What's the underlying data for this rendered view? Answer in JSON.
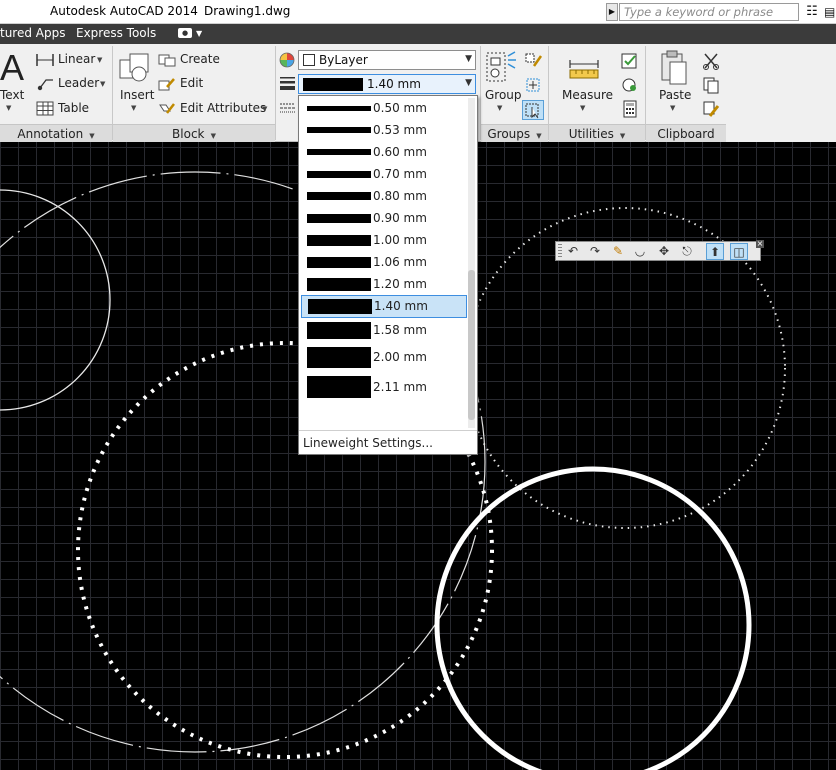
{
  "window": {
    "app_title": "Autodesk AutoCAD 2014",
    "document": "Drawing1.dwg",
    "search_placeholder": "Type a keyword or phrase"
  },
  "ribbon_tabs": [
    {
      "label": "tured Apps"
    },
    {
      "label": "Express Tools"
    }
  ],
  "annotation": {
    "text_label": "Text",
    "linear_label": "Linear",
    "leader_label": "Leader",
    "table_label": "Table",
    "panel_label": "Annotation"
  },
  "block": {
    "insert_label": "Insert",
    "create_label": "Create",
    "edit_label": "Edit",
    "edit_attributes_label": "Edit Attributes",
    "panel_label": "Block"
  },
  "properties": {
    "color_value": "ByLayer",
    "lineweight_value": "1.40 mm"
  },
  "groups": {
    "group_label": "Group",
    "panel_label": "Groups"
  },
  "utilities": {
    "measure_label": "Measure",
    "panel_label": "Utilities"
  },
  "clipboard": {
    "paste_label": "Paste",
    "panel_label": "Clipboard"
  },
  "lineweight_dropdown": {
    "items": [
      {
        "label": "0.50 mm",
        "weight": 0.5
      },
      {
        "label": "0.53 mm",
        "weight": 0.53
      },
      {
        "label": "0.60 mm",
        "weight": 0.6
      },
      {
        "label": "0.70 mm",
        "weight": 0.7
      },
      {
        "label": "0.80 mm",
        "weight": 0.8
      },
      {
        "label": "0.90 mm",
        "weight": 0.9
      },
      {
        "label": "1.00 mm",
        "weight": 1.0
      },
      {
        "label": "1.06 mm",
        "weight": 1.06
      },
      {
        "label": "1.20 mm",
        "weight": 1.2
      },
      {
        "label": "1.40 mm",
        "weight": 1.4
      },
      {
        "label": "1.58 mm",
        "weight": 1.58
      },
      {
        "label": "2.00 mm",
        "weight": 2.0
      },
      {
        "label": "2.11 mm",
        "weight": 2.11
      }
    ],
    "selected": "1.40 mm",
    "footer": "Lineweight Settings..."
  },
  "floating_toolbar": {
    "icons": [
      "undo-icon",
      "redo-icon",
      "match-properties-icon",
      "fillet-icon",
      "move-icon",
      "stretch-icon",
      "insert-block-icon",
      "block-editor-icon"
    ]
  },
  "colors": {
    "background": "#000000",
    "grid": "#28292f",
    "ribbon": "#f0f0f0",
    "tab_bar": "#3b3b3b",
    "selection": "#c9e3f7",
    "accent": "#3d8ee0"
  }
}
